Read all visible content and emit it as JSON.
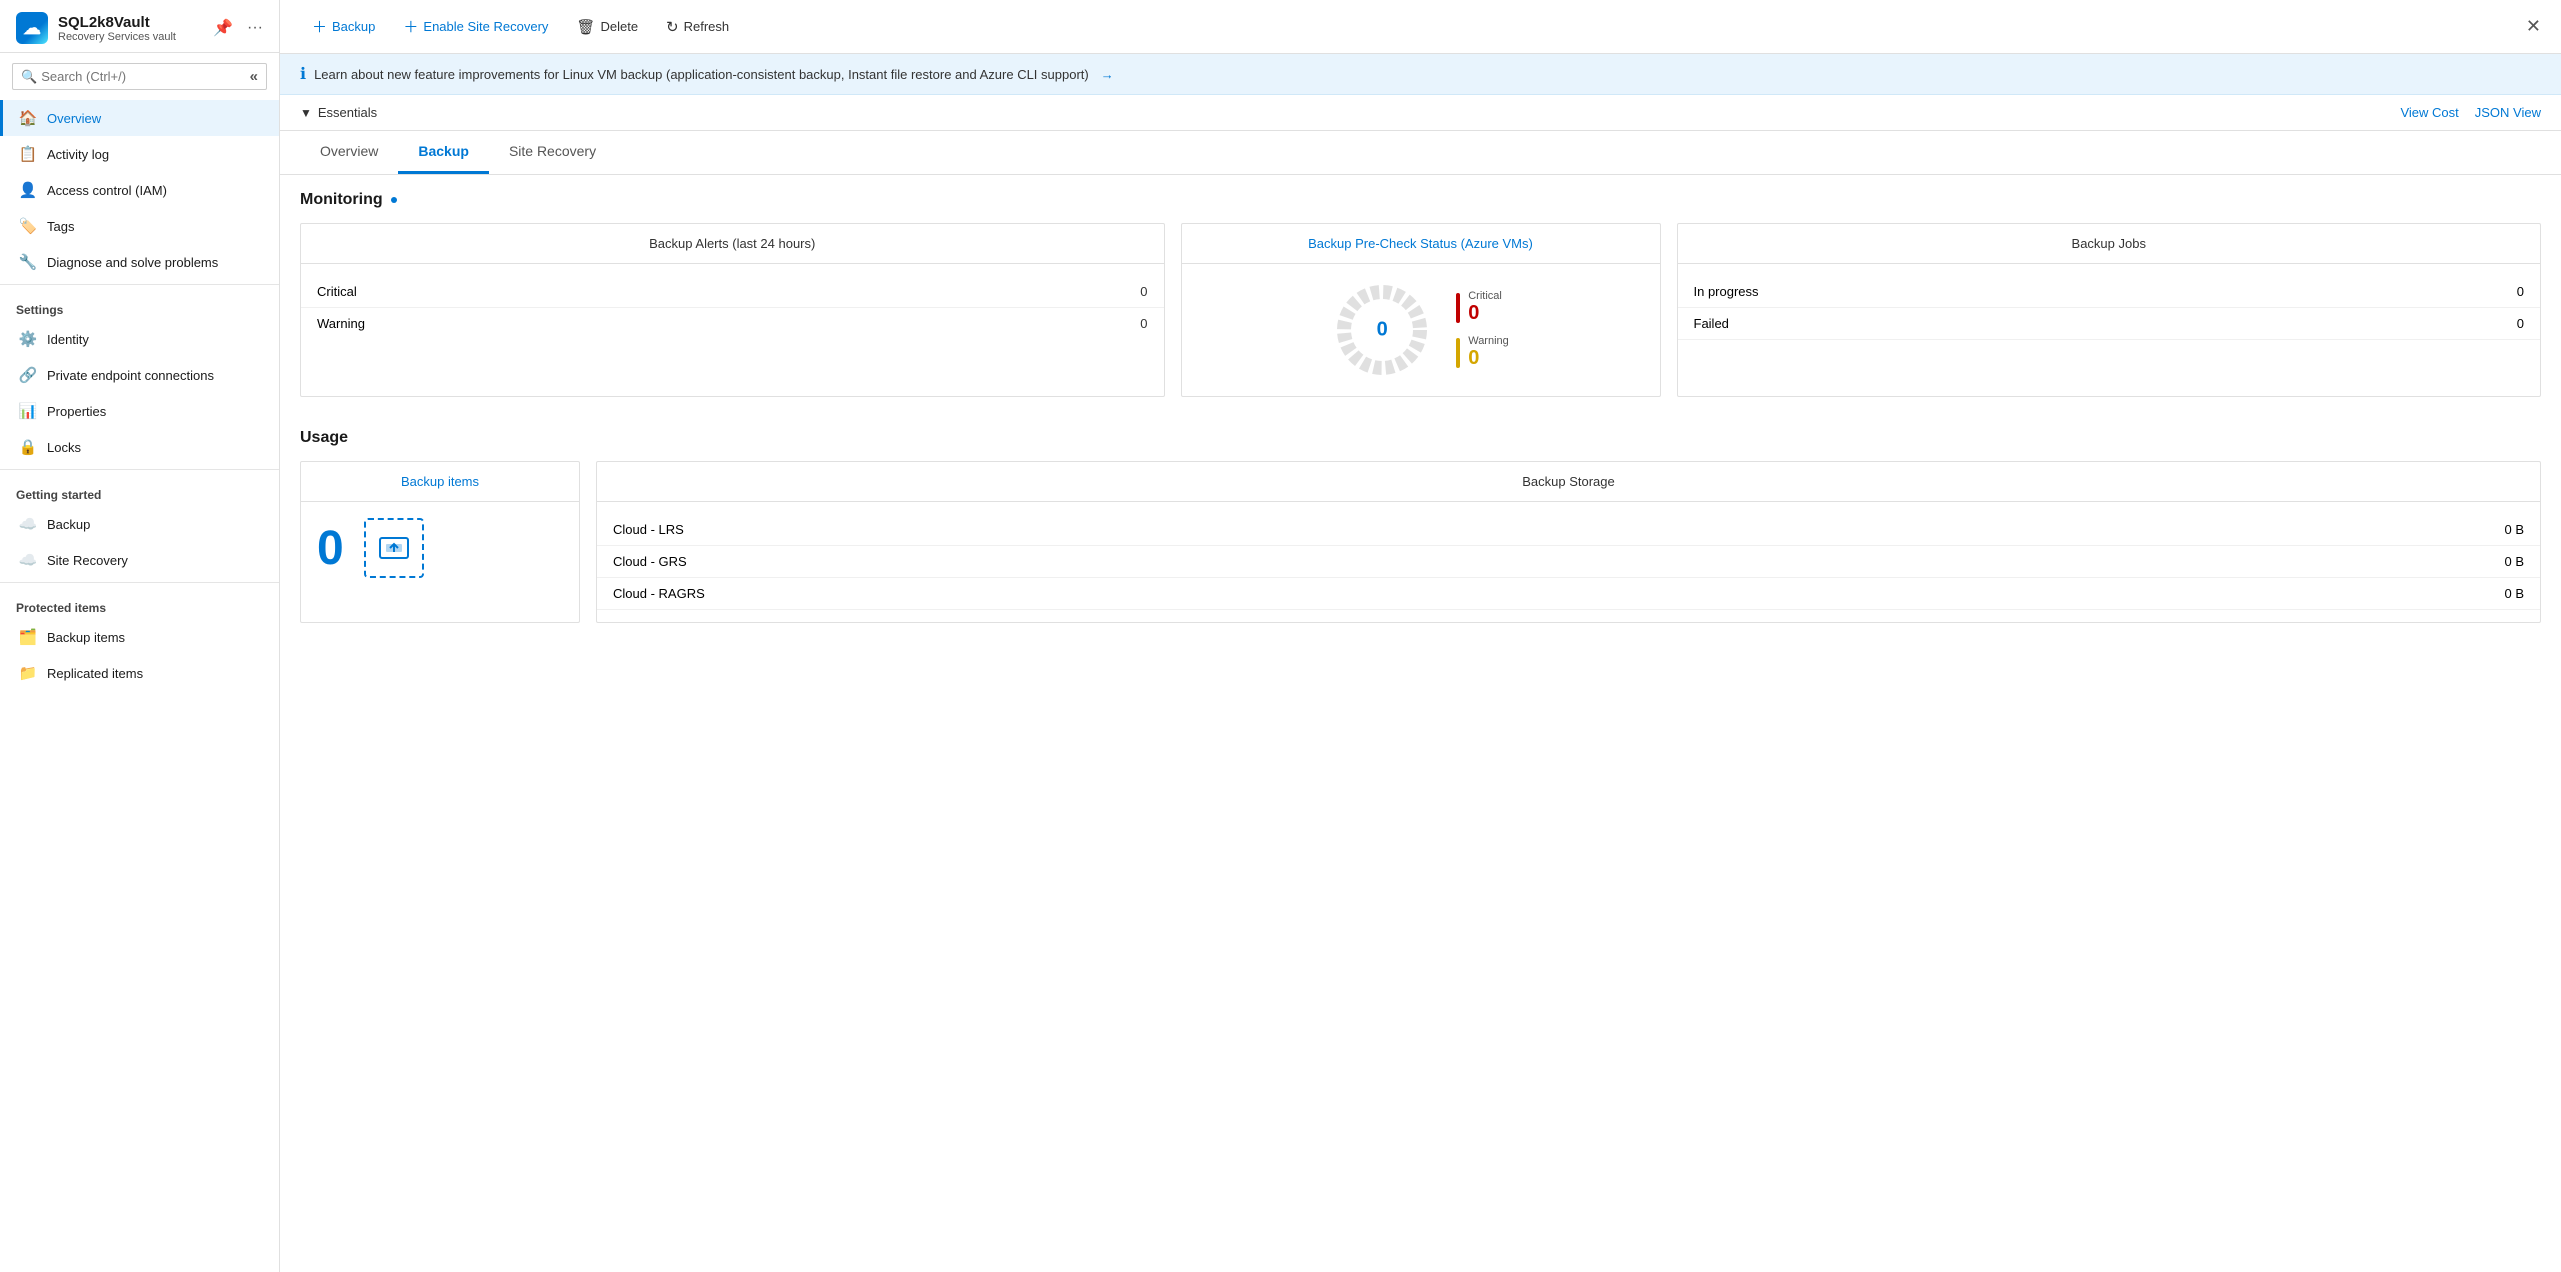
{
  "window": {
    "close_label": "✕"
  },
  "sidebar": {
    "app_name": "SQL2k8Vault",
    "app_subtitle": "Recovery Services vault",
    "search_placeholder": "Search (Ctrl+/)",
    "collapse_icon": "«",
    "nav_items": [
      {
        "id": "overview",
        "label": "Overview",
        "icon": "🏠",
        "active": true
      },
      {
        "id": "activity-log",
        "label": "Activity log",
        "icon": "📋",
        "active": false
      },
      {
        "id": "access-control",
        "label": "Access control (IAM)",
        "icon": "👤",
        "active": false
      },
      {
        "id": "tags",
        "label": "Tags",
        "icon": "🏷️",
        "active": false
      },
      {
        "id": "diagnose",
        "label": "Diagnose and solve problems",
        "icon": "🔧",
        "active": false
      }
    ],
    "settings_section": "Settings",
    "settings_items": [
      {
        "id": "identity",
        "label": "Identity",
        "icon": "⚙️",
        "active": false
      },
      {
        "id": "private-endpoint",
        "label": "Private endpoint connections",
        "icon": "🔗",
        "active": false
      },
      {
        "id": "properties",
        "label": "Properties",
        "icon": "📊",
        "active": false
      },
      {
        "id": "locks",
        "label": "Locks",
        "icon": "🔒",
        "active": false
      }
    ],
    "getting_started_section": "Getting started",
    "getting_started_items": [
      {
        "id": "backup-start",
        "label": "Backup",
        "icon": "☁️",
        "active": false
      },
      {
        "id": "site-recovery",
        "label": "Site Recovery",
        "icon": "☁️",
        "active": false
      }
    ],
    "protected_items_section": "Protected items",
    "protected_items": [
      {
        "id": "backup-items",
        "label": "Backup items",
        "icon": "🗂️",
        "active": false
      },
      {
        "id": "replicated-items",
        "label": "Replicated items",
        "icon": "📁",
        "active": false
      }
    ]
  },
  "toolbar": {
    "backup_label": "Backup",
    "enable_site_recovery_label": "Enable Site Recovery",
    "delete_label": "Delete",
    "refresh_label": "Refresh"
  },
  "info_bar": {
    "message": "Learn about new feature improvements for Linux VM backup (application-consistent backup, Instant file restore and Azure CLI support)",
    "arrow": "→"
  },
  "essentials": {
    "label": "Essentials",
    "view_cost_label": "View Cost",
    "json_view_label": "JSON View"
  },
  "tabs": [
    {
      "id": "tab-overview",
      "label": "Overview",
      "active": false
    },
    {
      "id": "tab-backup",
      "label": "Backup",
      "active": true
    },
    {
      "id": "tab-site-recovery",
      "label": "Site Recovery",
      "active": false
    }
  ],
  "monitoring": {
    "title": "Monitoring",
    "backup_alerts": {
      "header": "Backup Alerts (last 24 hours)",
      "rows": [
        {
          "label": "Critical",
          "value": "0"
        },
        {
          "label": "Warning",
          "value": "0"
        }
      ]
    },
    "precheck": {
      "header": "Backup Pre-Check Status (Azure VMs)",
      "center_value": "0",
      "legend": [
        {
          "label": "Critical",
          "value": "0",
          "color": "#c00000"
        },
        {
          "label": "Warning",
          "value": "0",
          "color": "#d4a600"
        }
      ]
    },
    "backup_jobs": {
      "header": "Backup Jobs",
      "rows": [
        {
          "label": "In progress",
          "value": "0"
        },
        {
          "label": "Failed",
          "value": "0"
        }
      ]
    }
  },
  "usage": {
    "title": "Usage",
    "backup_items": {
      "header": "Backup items",
      "count": "0"
    },
    "backup_storage": {
      "header": "Backup Storage",
      "rows": [
        {
          "label": "Cloud - LRS",
          "value": "0 B"
        },
        {
          "label": "Cloud - GRS",
          "value": "0 B"
        },
        {
          "label": "Cloud - RAGRS",
          "value": "0 B"
        }
      ]
    }
  }
}
